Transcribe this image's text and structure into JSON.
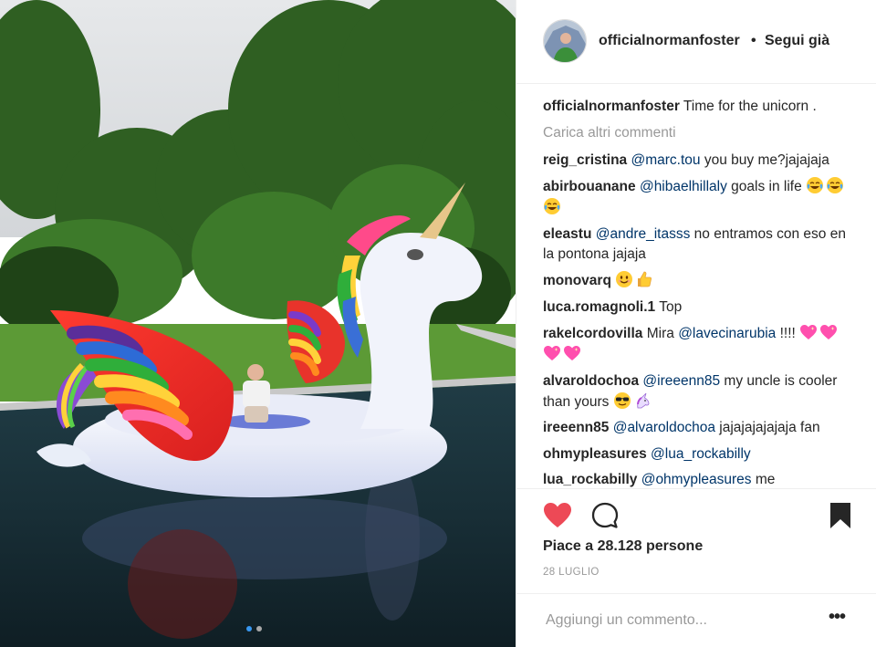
{
  "post": {
    "username": "officialnormanfoster",
    "separator": "•",
    "follow_status": "Segui già"
  },
  "comments_panel": {
    "load_more": "Carica altri commenti",
    "items": [
      {
        "user": "officialnormanfoster",
        "mention": "",
        "text": "Time for the unicorn .",
        "emojis": []
      },
      {
        "user": "reig_cristina",
        "mention": "@marc.tou",
        "text": "you buy me?jajajaja",
        "emojis": []
      },
      {
        "user": "abirbouanane",
        "mention": "@hibaelhillaly",
        "text": "goals in life",
        "emojis": [
          "face-with-tears-of-joy-icon",
          "face-with-tears-of-joy-icon",
          "face-with-tears-of-joy-icon"
        ]
      },
      {
        "user": "eleastu",
        "mention": "@andre_itasss",
        "text": "no entramos con eso en la pontona jajaja",
        "emojis": []
      },
      {
        "user": "monovarq",
        "mention": "",
        "text": "",
        "emojis": [
          "smiling-face-icon",
          "thumbs-up-icon"
        ]
      },
      {
        "user": "luca.romagnoli.1",
        "mention": "",
        "text": "Top",
        "emojis": []
      },
      {
        "user": "rakelcordovilla",
        "mention": "@lavecinarubia",
        "text_before": "Mira",
        "text": "!!!!",
        "emojis": [
          "sparkling-heart-icon",
          "sparkling-heart-icon",
          "sparkling-heart-icon",
          "sparkling-heart-icon"
        ]
      },
      {
        "user": "alvaroldochoa",
        "mention": "@ireeenn85",
        "text": "my uncle is cooler than yours",
        "emojis": [
          "sunglasses-face-icon",
          "unicorn-icon"
        ]
      },
      {
        "user": "ireeenn85",
        "mention": "@alvaroldochoa",
        "text": "jajajajajajaja fan",
        "emojis": []
      },
      {
        "user": "ohmypleasures",
        "mention": "@lua_rockabilly",
        "text": "",
        "emojis": []
      },
      {
        "user": "lua_rockabilly",
        "mention": "@ohmypleasures",
        "text": "me",
        "emojis": []
      }
    ]
  },
  "actions": {
    "like_icon": "heart-icon",
    "comment_icon": "speech-bubble-icon",
    "save_icon": "bookmark-icon",
    "liked_color": "#ed4956"
  },
  "likes_text": "Piace a 28.128 persone",
  "date_text": "28 LUGLIO",
  "comment_bar": {
    "placeholder": "Aggiungi un commento...",
    "more_label": "•••"
  },
  "carousel": {
    "active_color": "#3897f0",
    "inactive_color": "#a8a8a8"
  }
}
